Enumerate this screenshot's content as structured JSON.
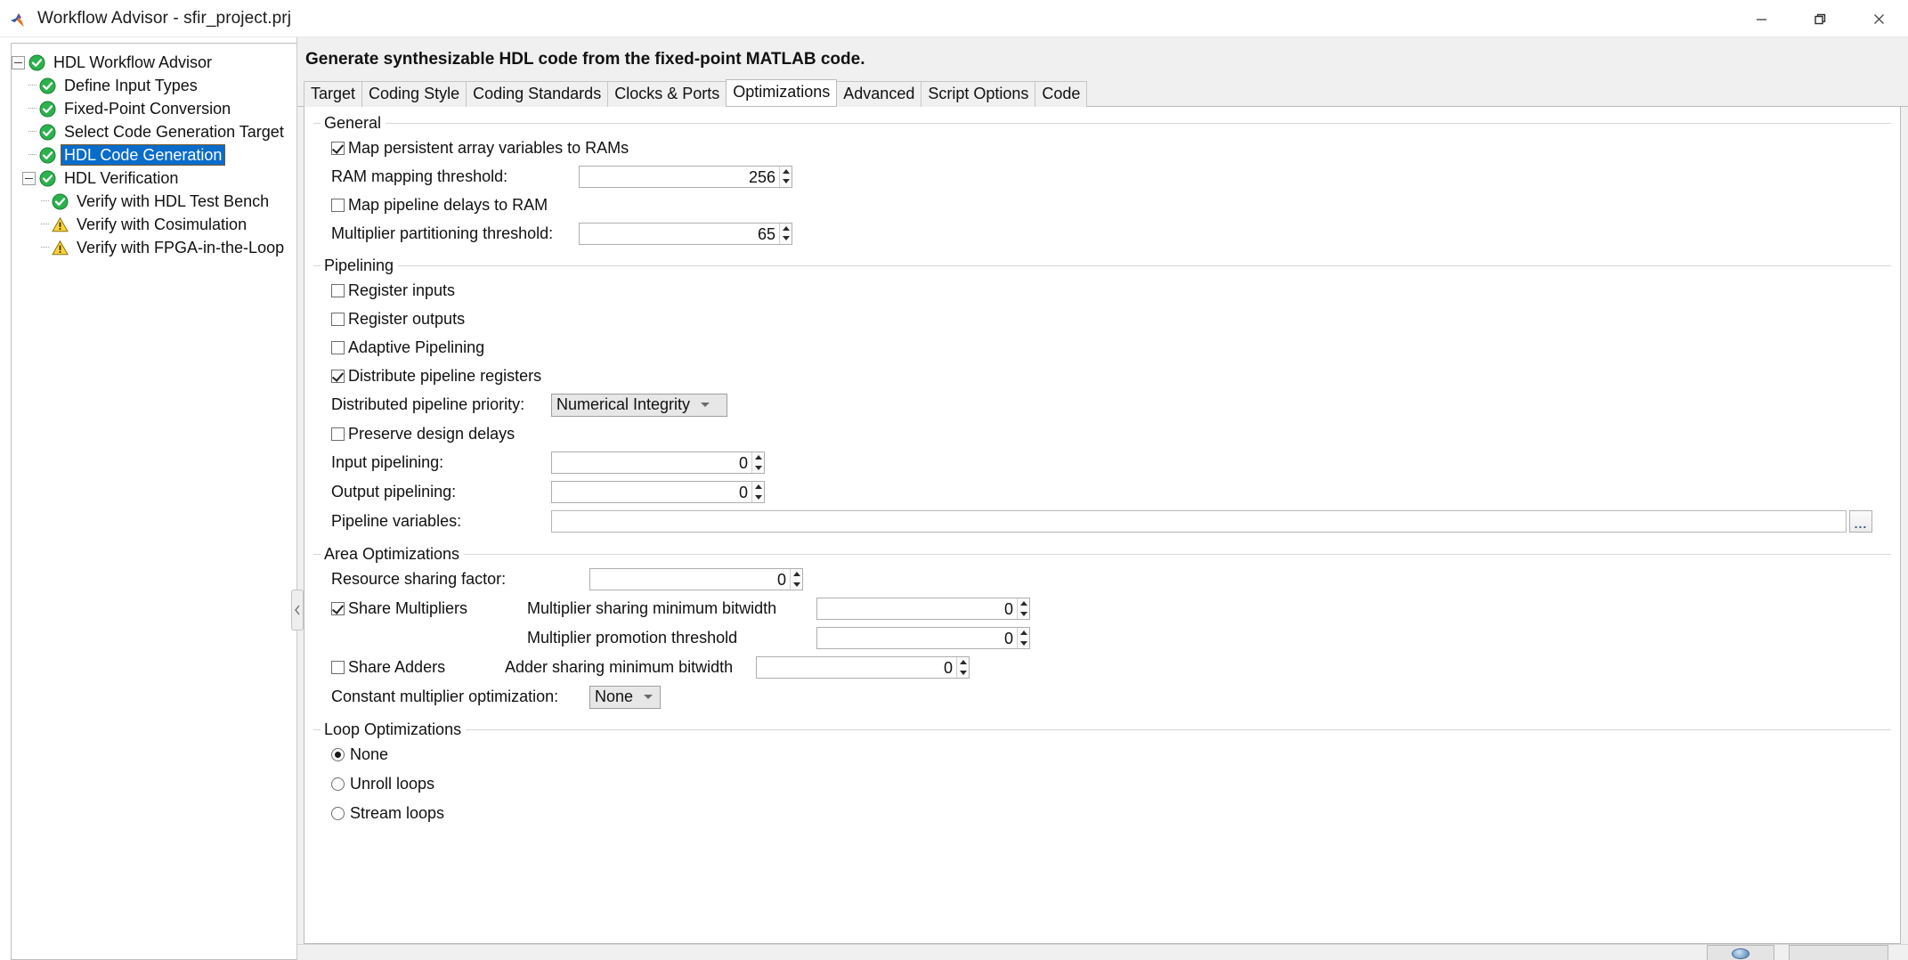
{
  "window": {
    "title": "Workflow Advisor - sfir_project.prj",
    "logo_icon": "matlab-logo-icon",
    "controls": [
      {
        "name": "minimize-button",
        "icon": "minimize-icon"
      },
      {
        "name": "restore-button",
        "icon": "restore-icon"
      },
      {
        "name": "close-button",
        "icon": "close-icon"
      }
    ]
  },
  "tree": {
    "items": [
      {
        "label": "HDL Workflow Advisor",
        "status": "pass",
        "level": 0,
        "expander": true,
        "selected": false
      },
      {
        "label": "Define Input Types",
        "status": "pass",
        "level": 1,
        "expander": false,
        "selected": false
      },
      {
        "label": "Fixed-Point Conversion",
        "status": "pass",
        "level": 1,
        "expander": false,
        "selected": false
      },
      {
        "label": "Select Code Generation Target",
        "status": "pass",
        "level": 1,
        "expander": false,
        "selected": false
      },
      {
        "label": "HDL Code Generation",
        "status": "pass",
        "level": 1,
        "expander": false,
        "selected": true
      },
      {
        "label": "HDL Verification",
        "status": "pass",
        "level": 1,
        "expander": true,
        "selected": false
      },
      {
        "label": "Verify with HDL Test Bench",
        "status": "pass",
        "level": 2,
        "expander": false,
        "selected": false
      },
      {
        "label": "Verify with Cosimulation",
        "status": "warning",
        "level": 2,
        "expander": false,
        "selected": false
      },
      {
        "label": "Verify with FPGA-in-the-Loop",
        "status": "warning",
        "level": 2,
        "expander": false,
        "selected": false
      }
    ]
  },
  "content": {
    "header": "Generate synthesizable HDL code from the fixed-point MATLAB code.",
    "tabs": [
      {
        "label": "Target",
        "active": false
      },
      {
        "label": "Coding Style",
        "active": false
      },
      {
        "label": "Coding Standards",
        "active": false
      },
      {
        "label": "Clocks & Ports",
        "active": false
      },
      {
        "label": "Optimizations",
        "active": true
      },
      {
        "label": "Advanced",
        "active": false
      },
      {
        "label": "Script Options",
        "active": false
      },
      {
        "label": "Code",
        "active": false
      }
    ]
  },
  "general": {
    "legend": "General",
    "map_persistent_label": "Map persistent array variables to RAMs",
    "map_persistent_checked": true,
    "ram_threshold_label": "RAM mapping threshold:",
    "ram_threshold_value": "256",
    "map_pipeline_delays_label": "Map pipeline delays to RAM",
    "map_pipeline_delays_checked": false,
    "mult_partition_label": "Multiplier partitioning threshold:",
    "mult_partition_value": "65"
  },
  "pipelining": {
    "legend": "Pipelining",
    "register_inputs_label": "Register inputs",
    "register_inputs_checked": false,
    "register_outputs_label": "Register outputs",
    "register_outputs_checked": false,
    "adaptive_label": "Adaptive Pipelining",
    "adaptive_checked": false,
    "distribute_label": "Distribute pipeline registers",
    "distribute_checked": true,
    "priority_label": "Distributed pipeline priority:",
    "priority_value": "Numerical Integrity",
    "preserve_label": "Preserve design delays",
    "preserve_checked": false,
    "input_pipelining_label": "Input pipelining:",
    "input_pipelining_value": "0",
    "output_pipelining_label": "Output pipelining:",
    "output_pipelining_value": "0",
    "pipeline_vars_label": "Pipeline variables:",
    "pipeline_vars_value": "",
    "browse_label": "..."
  },
  "area": {
    "legend": "Area Optimizations",
    "resource_sharing_label": "Resource sharing factor:",
    "resource_sharing_value": "0",
    "share_multipliers_label": "Share Multipliers",
    "share_multipliers_checked": true,
    "mult_sharing_bitwidth_label": "Multiplier sharing minimum bitwidth",
    "mult_sharing_bitwidth_value": "0",
    "mult_promotion_label": "Multiplier promotion threshold",
    "mult_promotion_value": "0",
    "share_adders_label": "Share Adders",
    "share_adders_checked": false,
    "adder_sharing_bitwidth_label": "Adder sharing minimum bitwidth",
    "adder_sharing_bitwidth_value": "0",
    "const_mult_label": "Constant multiplier optimization:",
    "const_mult_value": "None"
  },
  "loop": {
    "legend": "Loop Optimizations",
    "options": [
      {
        "label": "None",
        "selected": true
      },
      {
        "label": "Unroll loops",
        "selected": false
      },
      {
        "label": "Stream loops",
        "selected": false
      }
    ]
  },
  "footer": {
    "run_icon": "run-globe-icon",
    "run_label": "",
    "next_label": ""
  }
}
